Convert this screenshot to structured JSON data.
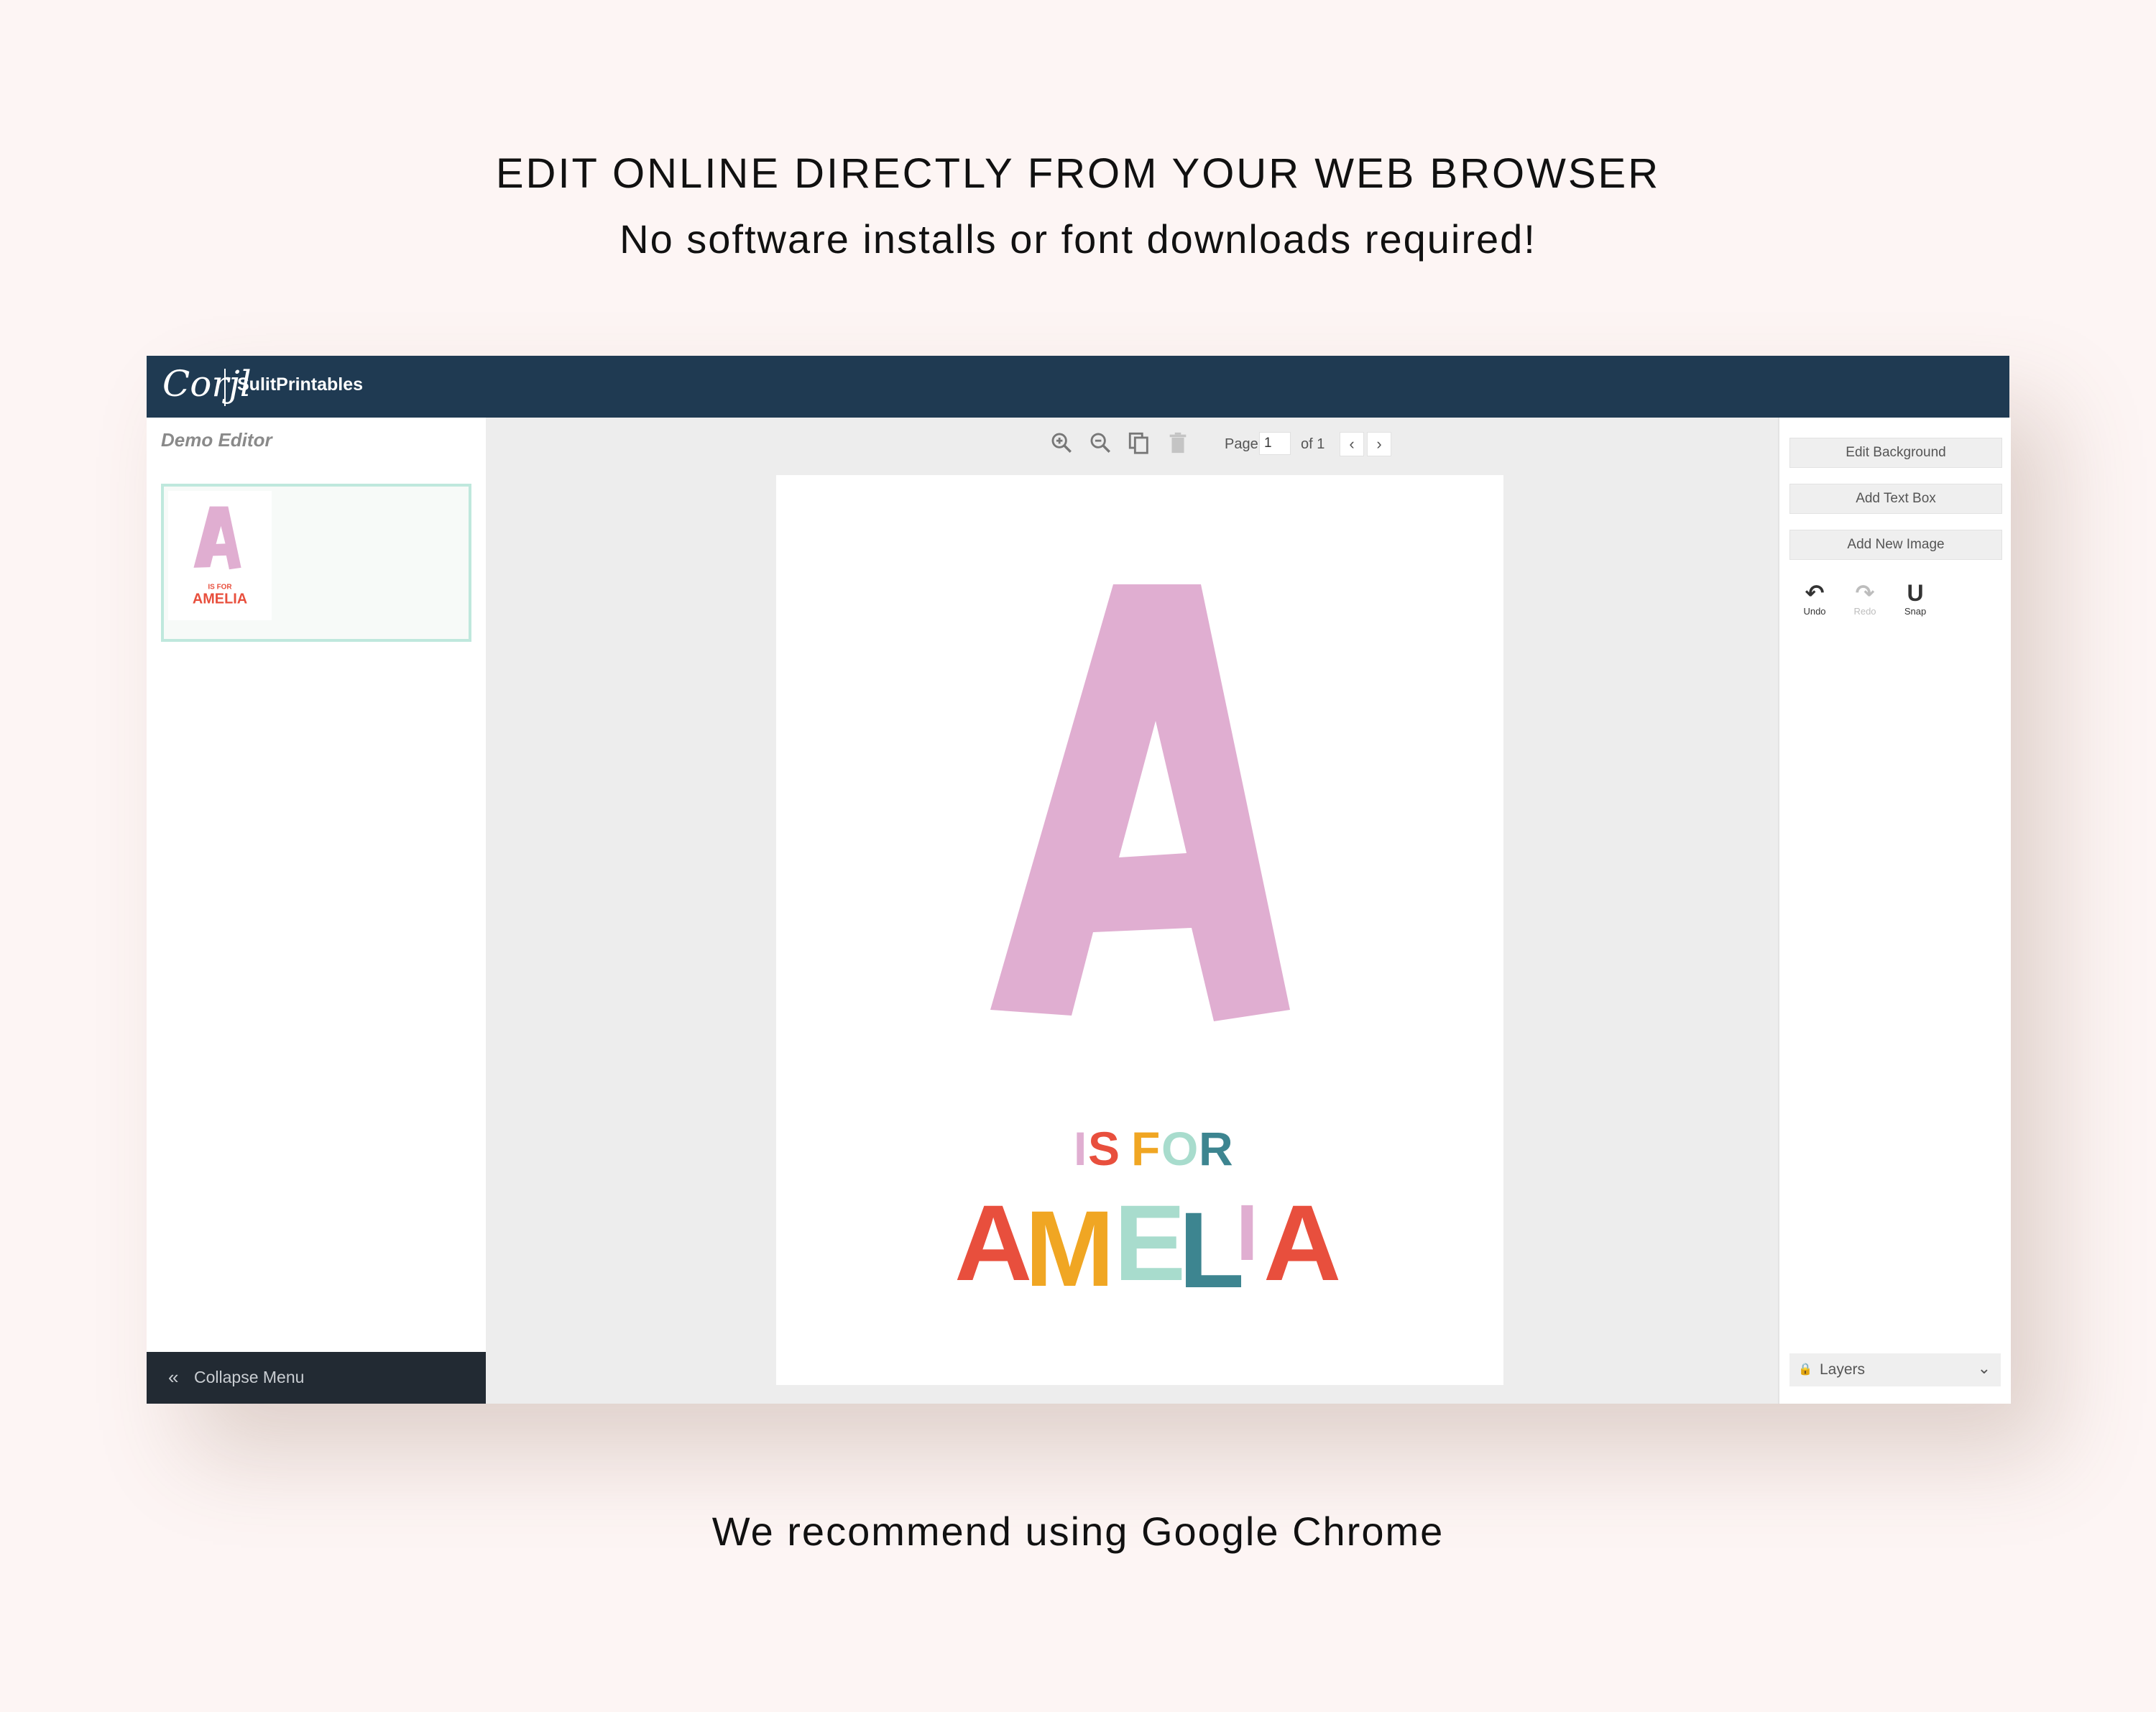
{
  "promo": {
    "heading": "EDIT ONLINE DIRECTLY FROM YOUR WEB BROWSER",
    "subheading": "No software installs or font downloads required!",
    "footer": "We recommend using Google Chrome"
  },
  "topbar": {
    "logo_text": "Corjl",
    "brand": "SulitPrintables"
  },
  "left_panel": {
    "title": "Demo Editor",
    "collapse_label": "Collapse Menu"
  },
  "toolbar": {
    "page_label": "Page",
    "page_value": "1",
    "page_of": "of 1",
    "icons": [
      "zoom-in-icon",
      "zoom-out-icon",
      "copy-icon",
      "trash-icon",
      "chevron-left-icon",
      "chevron-right-icon"
    ]
  },
  "right_panel": {
    "buttons": [
      "Edit Background",
      "Add Text Box",
      "Add New Image"
    ],
    "tools": [
      {
        "label": "Undo",
        "icon": "undo-icon",
        "enabled": true
      },
      {
        "label": "Redo",
        "icon": "redo-icon",
        "enabled": false
      },
      {
        "label": "Snap",
        "icon": "magnet-icon",
        "enabled": true
      }
    ],
    "layers_label": "Layers"
  },
  "design": {
    "big_letter": "A",
    "line1_letters": [
      "I",
      "S",
      " ",
      "F",
      "O",
      "R"
    ],
    "name_letters": [
      "A",
      "M",
      "E",
      "L",
      "I",
      "A"
    ],
    "colors": {
      "pink": "#e0aed1",
      "red": "#e84f3d",
      "yellow": "#f0a623",
      "mint": "#a8dccd",
      "teal": "#3d8590"
    }
  }
}
